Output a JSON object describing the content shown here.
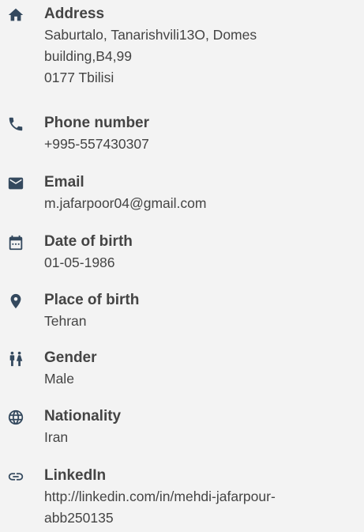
{
  "items": [
    {
      "icon": "home-icon",
      "label": "Address",
      "lines": [
        "Saburtalo, Tanarishvili13O, Domes",
        "building,B4,99",
        "0177 Tbilisi"
      ]
    },
    {
      "icon": "phone-icon",
      "label": "Phone number",
      "lines": [
        "+995-557430307"
      ]
    },
    {
      "icon": "email-icon",
      "label": "Email",
      "lines": [
        "m.jafarpoor04@gmail.com"
      ]
    },
    {
      "icon": "calendar-icon",
      "label": "Date of birth",
      "lines": [
        "01-05-1986"
      ]
    },
    {
      "icon": "location-pin-icon",
      "label": "Place of birth",
      "lines": [
        "Tehran"
      ]
    },
    {
      "icon": "gender-icon",
      "label": "Gender",
      "lines": [
        "Male"
      ]
    },
    {
      "icon": "globe-icon",
      "label": "Nationality",
      "lines": [
        "Iran"
      ]
    },
    {
      "icon": "link-icon",
      "label": "LinkedIn",
      "lines": [
        "http://linkedin.com/in/mehdi-jafarpour-",
        "abb250135"
      ]
    }
  ]
}
